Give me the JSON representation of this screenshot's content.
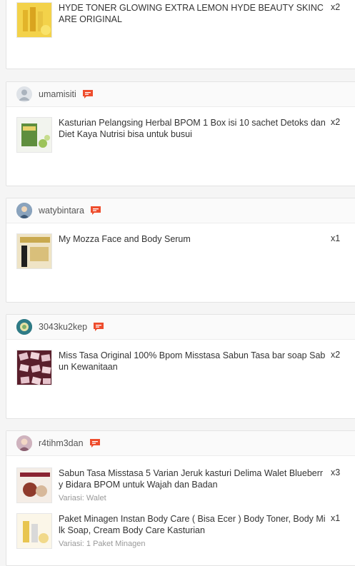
{
  "orders": [
    {
      "username": "",
      "items": [
        {
          "title": "HYDE TONER GLOWING EXTRA LEMON HYDE BEAUTY SKINCARE ORIGINAL",
          "qty": "x2",
          "variant": ""
        }
      ]
    },
    {
      "username": "umamisiti",
      "items": [
        {
          "title": "Kasturian Pelangsing Herbal BPOM 1 Box isi 10 sachet Detoks dan Diet Kaya Nutrisi bisa untuk busui",
          "qty": "x2",
          "variant": ""
        }
      ]
    },
    {
      "username": "watybintara",
      "items": [
        {
          "title": "My Mozza Face and Body Serum",
          "qty": "x1",
          "variant": ""
        }
      ]
    },
    {
      "username": "3043ku2kep",
      "items": [
        {
          "title": "Miss Tasa Original 100% Bpom Misstasa Sabun Tasa bar soap Sabun Kewanitaan",
          "qty": "x2",
          "variant": ""
        }
      ]
    },
    {
      "username": "r4tihm3dan",
      "items": [
        {
          "title": "Sabun Tasa Misstasa 5 Varian Jeruk kasturi Delima Walet Blueberry Bidara BPOM untuk Wajah dan Badan",
          "qty": "x3",
          "variant": "Variasi: Walet"
        },
        {
          "title": "Paket Minagen Instan Body Care ( Bisa Ecer ) Body Toner, Body Milk Soap, Cream Body Care Kasturian",
          "qty": "x1",
          "variant": "Variasi: 1 Paket Minagen"
        }
      ]
    }
  ],
  "icons": {
    "chat": "chat-icon",
    "avatar": "avatar-icon"
  },
  "colors": {
    "chat_accent": "#ee4d2d",
    "border": "#e3e3e3",
    "variant_text": "#999999"
  }
}
